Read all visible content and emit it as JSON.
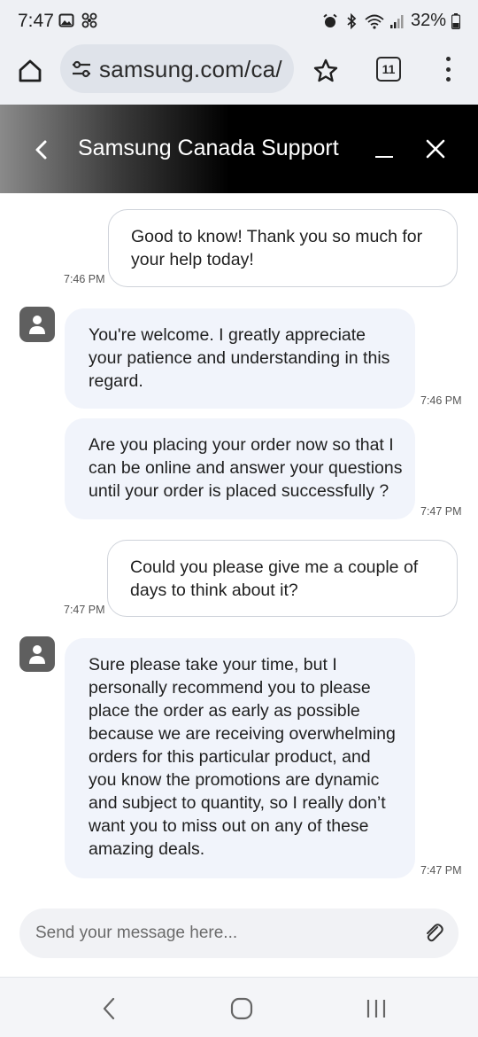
{
  "status_bar": {
    "time": "7:47",
    "battery": "32%"
  },
  "browser": {
    "url": "samsung.com/ca/",
    "tab_count": "11"
  },
  "chat": {
    "title": "Samsung Canada Support",
    "messages": [
      {
        "sender": "user",
        "lines": [
          "Good to know! Thank you so much for",
          "your help today!"
        ],
        "time": "7:46 PM"
      },
      {
        "sender": "agent",
        "lines": [
          "You're welcome. I greatly appreciate",
          "your patience and understanding in this",
          "regard."
        ],
        "time": "7:46 PM"
      },
      {
        "sender": "agent",
        "lines": [
          "Are you placing your order now so that I",
          "can be online and answer your questions",
          "until your order is placed successfully ?"
        ],
        "time": "7:47 PM"
      },
      {
        "sender": "user",
        "lines": [
          "Could you please give me a couple of",
          "days to think about it?"
        ],
        "time": "7:47 PM"
      },
      {
        "sender": "agent",
        "lines": [
          "Sure please take your time, but I",
          "personally recommend you to please",
          "place the order as early as possible",
          "because we are receiving overwhelming",
          "orders for this particular product, and",
          "you know the promotions are dynamic",
          "and subject to quantity, so I really don’t",
          "want you to miss out on any of these",
          "amazing deals."
        ],
        "time": "7:47 PM"
      }
    ]
  },
  "composer": {
    "placeholder": "Send your message here..."
  },
  "icons": {
    "home": "home-icon",
    "tune": "site-settings-icon",
    "star": "star-icon",
    "menu": "more-vert-icon",
    "back": "chevron-left-icon",
    "minimize": "minimize-icon",
    "close": "close-icon",
    "avatar": "person-icon",
    "attach": "paperclip-icon"
  }
}
